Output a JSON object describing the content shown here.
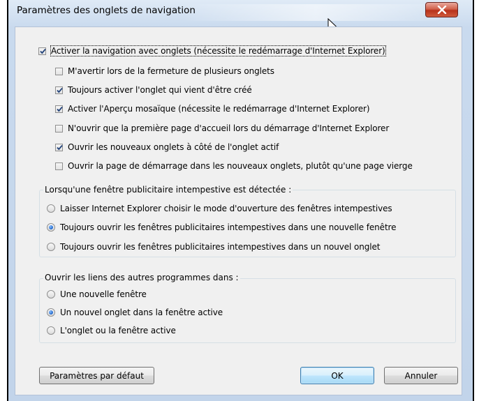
{
  "window": {
    "title": "Paramètres des onglets de navigation",
    "close_icon": "close-x-icon"
  },
  "colors": {
    "accent": "#1d64c8",
    "close_red": "#c7432a",
    "group_border": "#d5dfe5"
  },
  "tabs_options": {
    "main": {
      "label": "Activer la navigation avec onglets (nécessite le redémarrage d'Internet Explorer)",
      "checked": true
    },
    "sub": [
      {
        "label": "M'avertir lors de la fermeture de plusieurs onglets",
        "checked": false
      },
      {
        "label": "Toujours activer l'onglet qui vient d'être créé",
        "checked": true
      },
      {
        "label": "Activer l'Aperçu mosaïque (nécessite le redémarrage d'Internet Explorer)",
        "checked": true
      },
      {
        "label": "N'ouvrir que la première page d'accueil lors du démarrage d'Internet Explorer",
        "checked": false
      },
      {
        "label": "Ouvrir les nouveaux onglets à côté de l'onglet actif",
        "checked": true
      },
      {
        "label": "Ouvrir la page de démarrage dans les nouveaux onglets, plutôt qu'une page vierge",
        "checked": false
      }
    ]
  },
  "popup_group": {
    "title": "Lorsqu'une fenêtre publicitaire intempestive est détectée :",
    "options": [
      {
        "label": "Laisser Internet Explorer choisir le mode d'ouverture des fenêtres intempestives",
        "selected": false
      },
      {
        "label": "Toujours ouvrir les fenêtres publicitaires intempestives dans une nouvelle fenêtre",
        "selected": true
      },
      {
        "label": "Toujours ouvrir les fenêtres publicitaires intempestives dans un nouvel onglet",
        "selected": false
      }
    ]
  },
  "links_group": {
    "title": "Ouvrir les liens des autres programmes dans :",
    "options": [
      {
        "label": "Une nouvelle fenêtre",
        "selected": false
      },
      {
        "label": "Un nouvel onglet dans la fenêtre active",
        "selected": true
      },
      {
        "label": "L'onglet ou la fenêtre active",
        "selected": false
      }
    ]
  },
  "buttons": {
    "defaults": "Paramètres par défaut",
    "ok": "OK",
    "cancel": "Annuler"
  }
}
